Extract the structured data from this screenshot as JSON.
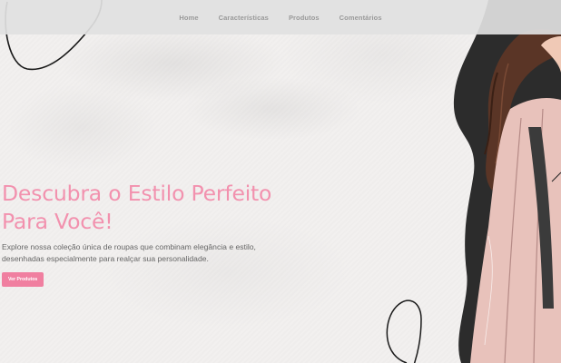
{
  "nav": {
    "links": [
      {
        "label": "Home"
      },
      {
        "label": "Características"
      },
      {
        "label": "Produtos"
      },
      {
        "label": "Comentários"
      }
    ]
  },
  "hero": {
    "title_line1": "Descubra o Estilo Perfeito",
    "title_line2": "Para Você!",
    "desc_line1": "Explore nossa coleção única de roupas que combinam elegância e estilo,",
    "desc_line2": "desenhadas especialmente para realçar sua personalidade.",
    "button_label": "Ver Produtos"
  },
  "colors": {
    "accent": "#f07fa0",
    "title": "#f291ae",
    "nav_bg": "#e1e1e1",
    "blob": "#2b2b2b"
  },
  "image": {
    "icon": "fashion-illustration"
  }
}
